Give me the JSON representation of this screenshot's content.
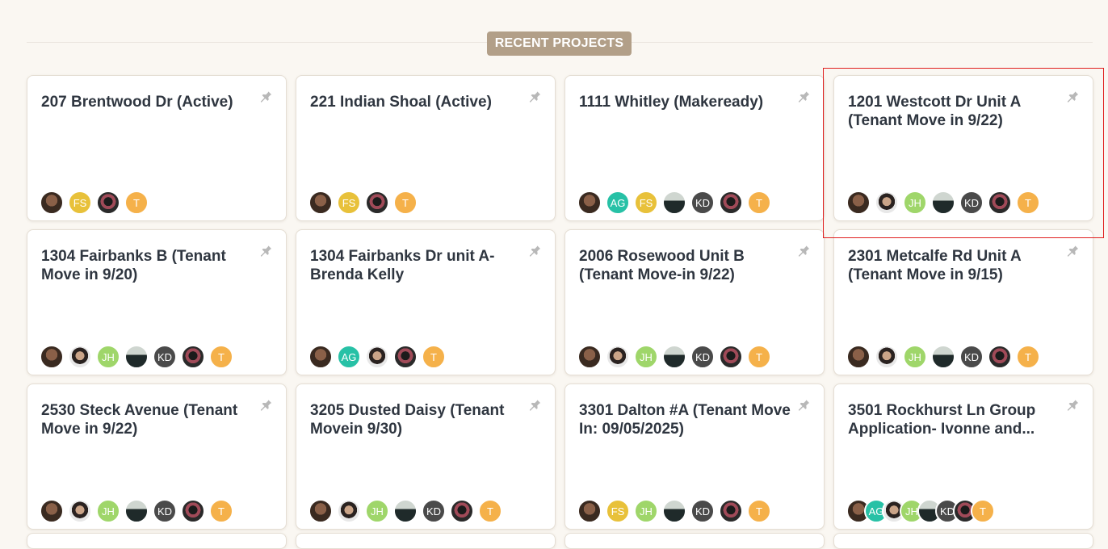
{
  "header": {
    "title": "RECENT PROJECTS"
  },
  "projects": [
    {
      "title": "207 Brentwood Dr (Active)",
      "avatars": [
        {
          "type": "photo",
          "style": "p1"
        },
        {
          "type": "initials",
          "text": "FS",
          "style": "fs"
        },
        {
          "type": "photo",
          "style": "p2"
        },
        {
          "type": "initials",
          "text": "T",
          "style": "t"
        }
      ]
    },
    {
      "title": "221 Indian Shoal (Active)",
      "avatars": [
        {
          "type": "photo",
          "style": "p1"
        },
        {
          "type": "initials",
          "text": "FS",
          "style": "fs"
        },
        {
          "type": "photo",
          "style": "p2"
        },
        {
          "type": "initials",
          "text": "T",
          "style": "t"
        }
      ]
    },
    {
      "title": "1111 Whitley (Makeready)",
      "avatars": [
        {
          "type": "photo",
          "style": "p1"
        },
        {
          "type": "initials",
          "text": "AG",
          "style": "ag"
        },
        {
          "type": "initials",
          "text": "FS",
          "style": "fs"
        },
        {
          "type": "photo",
          "style": "p4"
        },
        {
          "type": "initials",
          "text": "KD",
          "style": "kd"
        },
        {
          "type": "photo",
          "style": "p2"
        },
        {
          "type": "initials",
          "text": "T",
          "style": "t"
        }
      ]
    },
    {
      "title": "1201 Westcott Dr Unit A (Tenant Move in 9/22)",
      "selected": true,
      "avatars": [
        {
          "type": "photo",
          "style": "p1"
        },
        {
          "type": "photo",
          "style": "p3"
        },
        {
          "type": "initials",
          "text": "JH",
          "style": "jh"
        },
        {
          "type": "photo",
          "style": "p4"
        },
        {
          "type": "initials",
          "text": "KD",
          "style": "kd"
        },
        {
          "type": "photo",
          "style": "p2"
        },
        {
          "type": "initials",
          "text": "T",
          "style": "t"
        }
      ]
    },
    {
      "title": "1304 Fairbanks B (Tenant Move in 9/20)",
      "avatars": [
        {
          "type": "photo",
          "style": "p1"
        },
        {
          "type": "photo",
          "style": "p3"
        },
        {
          "type": "initials",
          "text": "JH",
          "style": "jh"
        },
        {
          "type": "photo",
          "style": "p4"
        },
        {
          "type": "initials",
          "text": "KD",
          "style": "kd"
        },
        {
          "type": "photo",
          "style": "p2"
        },
        {
          "type": "initials",
          "text": "T",
          "style": "t"
        }
      ]
    },
    {
      "title": "1304 Fairbanks Dr unit A- Brenda Kelly",
      "avatars": [
        {
          "type": "photo",
          "style": "p1"
        },
        {
          "type": "initials",
          "text": "AG",
          "style": "ag"
        },
        {
          "type": "photo",
          "style": "p3"
        },
        {
          "type": "photo",
          "style": "p2"
        },
        {
          "type": "initials",
          "text": "T",
          "style": "t"
        }
      ]
    },
    {
      "title": "2006 Rosewood Unit B (Tenant Move-in 9/22)",
      "avatars": [
        {
          "type": "photo",
          "style": "p1"
        },
        {
          "type": "photo",
          "style": "p3"
        },
        {
          "type": "initials",
          "text": "JH",
          "style": "jh"
        },
        {
          "type": "photo",
          "style": "p4"
        },
        {
          "type": "initials",
          "text": "KD",
          "style": "kd"
        },
        {
          "type": "photo",
          "style": "p2"
        },
        {
          "type": "initials",
          "text": "T",
          "style": "t"
        }
      ]
    },
    {
      "title": "2301 Metcalfe Rd Unit A (Tenant Move in 9/15)",
      "avatars": [
        {
          "type": "photo",
          "style": "p1"
        },
        {
          "type": "photo",
          "style": "p3"
        },
        {
          "type": "initials",
          "text": "JH",
          "style": "jh"
        },
        {
          "type": "photo",
          "style": "p4"
        },
        {
          "type": "initials",
          "text": "KD",
          "style": "kd"
        },
        {
          "type": "photo",
          "style": "p2"
        },
        {
          "type": "initials",
          "text": "T",
          "style": "t"
        }
      ]
    },
    {
      "title": "2530 Steck Avenue (Tenant Move in 9/22)",
      "avatars": [
        {
          "type": "photo",
          "style": "p1"
        },
        {
          "type": "photo",
          "style": "p3"
        },
        {
          "type": "initials",
          "text": "JH",
          "style": "jh"
        },
        {
          "type": "photo",
          "style": "p4"
        },
        {
          "type": "initials",
          "text": "KD",
          "style": "kd"
        },
        {
          "type": "photo",
          "style": "p2"
        },
        {
          "type": "initials",
          "text": "T",
          "style": "t"
        }
      ]
    },
    {
      "title": "3205 Dusted Daisy (Tenant Movein 9/30)",
      "avatars": [
        {
          "type": "photo",
          "style": "p1"
        },
        {
          "type": "photo",
          "style": "p3"
        },
        {
          "type": "initials",
          "text": "JH",
          "style": "jh"
        },
        {
          "type": "photo",
          "style": "p4"
        },
        {
          "type": "initials",
          "text": "KD",
          "style": "kd"
        },
        {
          "type": "photo",
          "style": "p2"
        },
        {
          "type": "initials",
          "text": "T",
          "style": "t"
        }
      ]
    },
    {
      "title": "3301 Dalton #A (Tenant Move In: 09/05/2025)",
      "avatars": [
        {
          "type": "photo",
          "style": "p1"
        },
        {
          "type": "initials",
          "text": "FS",
          "style": "fs"
        },
        {
          "type": "initials",
          "text": "JH",
          "style": "jh"
        },
        {
          "type": "photo",
          "style": "p4"
        },
        {
          "type": "initials",
          "text": "KD",
          "style": "kd"
        },
        {
          "type": "photo",
          "style": "p2"
        },
        {
          "type": "initials",
          "text": "T",
          "style": "t"
        }
      ]
    },
    {
      "title": "3501 Rockhurst Ln Group Application- Ivonne and...",
      "tight": true,
      "avatars": [
        {
          "type": "photo",
          "style": "p1"
        },
        {
          "type": "initials",
          "text": "AG",
          "style": "ag"
        },
        {
          "type": "photo",
          "style": "p3"
        },
        {
          "type": "initials",
          "text": "JH",
          "style": "jh"
        },
        {
          "type": "photo",
          "style": "p4"
        },
        {
          "type": "initials",
          "text": "KD",
          "style": "kd"
        },
        {
          "type": "photo",
          "style": "p2"
        },
        {
          "type": "initials",
          "text": "T",
          "style": "t"
        }
      ]
    }
  ]
}
